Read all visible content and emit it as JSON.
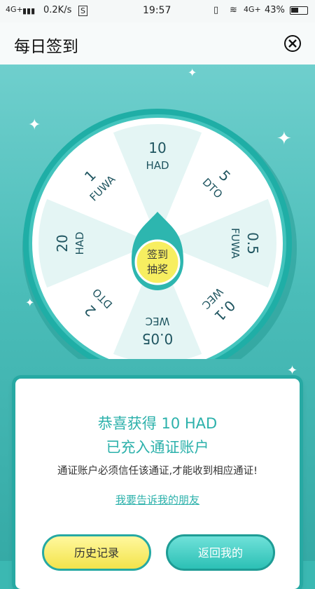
{
  "status_bar": {
    "network": "4G+",
    "speed": "0.2K/s",
    "time": "19:57",
    "network_right": "4G+",
    "battery": "43%"
  },
  "header": {
    "title": "每日签到"
  },
  "wheel": {
    "center_label_1": "签到",
    "center_label_2": "抽奖",
    "segments": [
      {
        "value": "10",
        "unit": "HAD"
      },
      {
        "value": "5",
        "unit": "DTO"
      },
      {
        "value": "0.5",
        "unit": "FUWA"
      },
      {
        "value": "0.1",
        "unit": "WEC"
      },
      {
        "value": "0.05",
        "unit": "WEC"
      },
      {
        "value": "2",
        "unit": "DTO"
      },
      {
        "value": "20",
        "unit": "HAD"
      },
      {
        "value": "1",
        "unit": "FUWA"
      }
    ]
  },
  "result": {
    "line1": "恭喜获得 10 HAD",
    "line2": "已充入通证账户",
    "note": "通证账户必须信任该通证,才能收到相应通证!",
    "share_link": "我要告诉我的朋友"
  },
  "buttons": {
    "history": "历史记录",
    "back": "返回我的"
  },
  "colors": {
    "teal": "#2cb1ab",
    "yellow": "#f3e34b",
    "light_segment": "#e4f5f4"
  }
}
